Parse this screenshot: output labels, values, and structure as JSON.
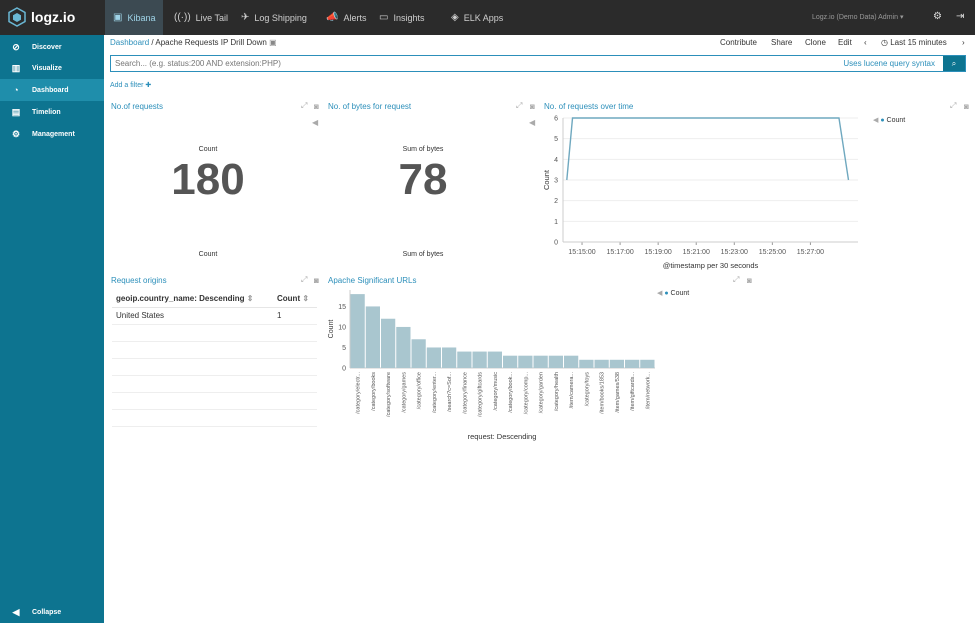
{
  "brand": {
    "name": "logz.io"
  },
  "topnav": [
    {
      "label": "Kibana",
      "icon": "kibana-icon"
    },
    {
      "label": "Live Tail",
      "icon": "live-tail-icon"
    },
    {
      "label": "Log Shipping",
      "icon": "log-shipping-icon"
    },
    {
      "label": "Alerts",
      "icon": "alerts-icon"
    },
    {
      "label": "Insights",
      "icon": "insights-icon"
    },
    {
      "label": "ELK Apps",
      "icon": "elk-apps-icon"
    }
  ],
  "user": {
    "label": "Logz.io (Demo Data) Admin"
  },
  "sidebar": {
    "items": [
      {
        "label": "Discover",
        "icon": "compass-icon"
      },
      {
        "label": "Visualize",
        "icon": "bar-chart-icon"
      },
      {
        "label": "Dashboard",
        "icon": "dashboard-icon"
      },
      {
        "label": "Timelion",
        "icon": "timelion-icon"
      },
      {
        "label": "Management",
        "icon": "gear-icon"
      }
    ],
    "collapse": "Collapse"
  },
  "breadcrumb": {
    "root": "Dashboard",
    "separator": "/",
    "current": "Apache Requests IP Drill Down"
  },
  "actions": {
    "contribute": "Contribute",
    "share": "Share",
    "clone": "Clone",
    "edit": "Edit",
    "time": "Last 15 minutes"
  },
  "search": {
    "placeholder": "Search... (e.g. status:200 AND extension:PHP)",
    "syntax": "Uses lucene query syntax"
  },
  "add_filter": "Add a filter",
  "panels": {
    "requests": {
      "title": "No.of requests",
      "label_top": "Count",
      "value": "180",
      "label_bottom": "Count"
    },
    "bytes": {
      "title": "No. of bytes for request",
      "label_top": "Sum of bytes",
      "value": "78",
      "label_bottom": "Sum of bytes"
    },
    "time": {
      "title": "No. of requests over time",
      "legend": "Count",
      "xlabel": "@timestamp per 30 seconds",
      "ylabel": "Count"
    },
    "origins": {
      "title": "Request origins",
      "col1": "geoip.country_name: Descending",
      "col2": "Count",
      "rows": [
        {
          "country": "United States",
          "count": "1"
        }
      ]
    },
    "urls": {
      "title": "Apache Significant URLs",
      "legend": "Count",
      "xlabel": "request: Descending",
      "ylabel": "Count"
    }
  },
  "colors": {
    "accent": "#2c8fba",
    "sidebar": "#0d7490",
    "bar": "#a9c6cf",
    "line": "#6fa8bf"
  },
  "chart_data": [
    {
      "type": "line",
      "title": "No. of requests over time",
      "xlabel": "@timestamp per 30 seconds",
      "ylabel": "Count",
      "ylim": [
        0,
        6
      ],
      "yticks": [
        0,
        1,
        2,
        3,
        4,
        5,
        6
      ],
      "xticks": [
        "15:15:00",
        "15:17:00",
        "15:19:00",
        "15:21:00",
        "15:23:00",
        "15:25:00",
        "15:27:00"
      ],
      "series": [
        {
          "name": "Count",
          "x": [
            14.2,
            14.5,
            15.0,
            15.5,
            16.0,
            16.5,
            17.0,
            17.5,
            18.0,
            18.5,
            19.0,
            19.5,
            20.0,
            20.5,
            21.0,
            21.5,
            22.0,
            22.5,
            23.0,
            23.5,
            24.0,
            24.5,
            25.0,
            25.5,
            26.0,
            26.5,
            27.0,
            27.5,
            28.0,
            28.5,
            29.0
          ],
          "y": [
            3,
            6,
            6,
            6,
            6,
            6,
            6,
            6,
            6,
            6,
            6,
            6,
            6,
            6,
            6,
            6,
            6,
            6,
            6,
            6,
            6,
            6,
            6,
            6,
            6,
            6,
            6,
            6,
            6,
            6,
            3
          ]
        }
      ]
    },
    {
      "type": "bar",
      "title": "Apache Significant URLs",
      "xlabel": "request: Descending",
      "ylabel": "Count",
      "ylim": [
        0,
        19
      ],
      "yticks": [
        0,
        5,
        10,
        15
      ],
      "categories": [
        "/category/electr...",
        "/category/books",
        "/category/software",
        "/category/games",
        "/category/office",
        "/category/enter...",
        "/search?c=Sof...",
        "/category/finance",
        "/category/giftcards",
        "/category/music",
        "/category/book...",
        "/category/comp...",
        "/category/garden",
        "/category/health",
        "/item/camera...",
        "/category/toys",
        "/item/books/1853",
        "/item/games/538",
        "/item/giftcards...",
        "/item/network..."
      ],
      "series": [
        {
          "name": "Count",
          "values": [
            18,
            15,
            12,
            10,
            7,
            5,
            5,
            4,
            4,
            4,
            3,
            3,
            3,
            3,
            3,
            2,
            2,
            2,
            2,
            2
          ]
        }
      ]
    }
  ]
}
